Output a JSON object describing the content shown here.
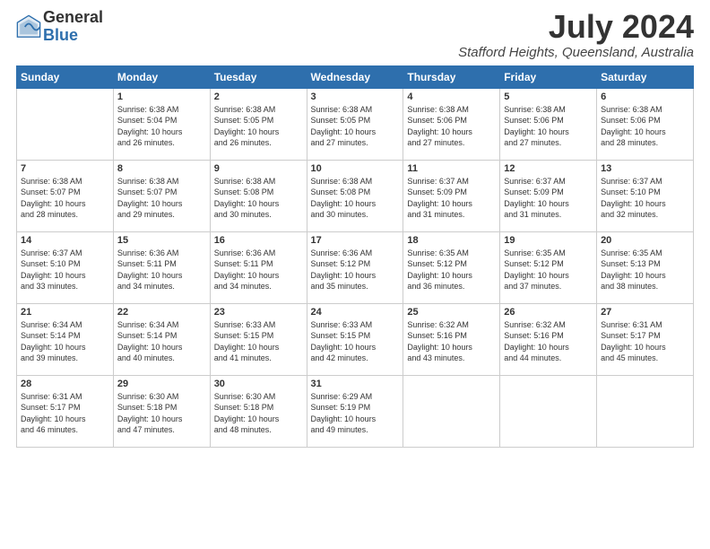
{
  "header": {
    "logo_general": "General",
    "logo_blue": "Blue",
    "month_year": "July 2024",
    "location": "Stafford Heights, Queensland, Australia"
  },
  "weekdays": [
    "Sunday",
    "Monday",
    "Tuesday",
    "Wednesday",
    "Thursday",
    "Friday",
    "Saturday"
  ],
  "weeks": [
    [
      {
        "day": "",
        "info": ""
      },
      {
        "day": "1",
        "info": "Sunrise: 6:38 AM\nSunset: 5:04 PM\nDaylight: 10 hours\nand 26 minutes."
      },
      {
        "day": "2",
        "info": "Sunrise: 6:38 AM\nSunset: 5:05 PM\nDaylight: 10 hours\nand 26 minutes."
      },
      {
        "day": "3",
        "info": "Sunrise: 6:38 AM\nSunset: 5:05 PM\nDaylight: 10 hours\nand 27 minutes."
      },
      {
        "day": "4",
        "info": "Sunrise: 6:38 AM\nSunset: 5:06 PM\nDaylight: 10 hours\nand 27 minutes."
      },
      {
        "day": "5",
        "info": "Sunrise: 6:38 AM\nSunset: 5:06 PM\nDaylight: 10 hours\nand 27 minutes."
      },
      {
        "day": "6",
        "info": "Sunrise: 6:38 AM\nSunset: 5:06 PM\nDaylight: 10 hours\nand 28 minutes."
      }
    ],
    [
      {
        "day": "7",
        "info": "Sunrise: 6:38 AM\nSunset: 5:07 PM\nDaylight: 10 hours\nand 28 minutes."
      },
      {
        "day": "8",
        "info": "Sunrise: 6:38 AM\nSunset: 5:07 PM\nDaylight: 10 hours\nand 29 minutes."
      },
      {
        "day": "9",
        "info": "Sunrise: 6:38 AM\nSunset: 5:08 PM\nDaylight: 10 hours\nand 30 minutes."
      },
      {
        "day": "10",
        "info": "Sunrise: 6:38 AM\nSunset: 5:08 PM\nDaylight: 10 hours\nand 30 minutes."
      },
      {
        "day": "11",
        "info": "Sunrise: 6:37 AM\nSunset: 5:09 PM\nDaylight: 10 hours\nand 31 minutes."
      },
      {
        "day": "12",
        "info": "Sunrise: 6:37 AM\nSunset: 5:09 PM\nDaylight: 10 hours\nand 31 minutes."
      },
      {
        "day": "13",
        "info": "Sunrise: 6:37 AM\nSunset: 5:10 PM\nDaylight: 10 hours\nand 32 minutes."
      }
    ],
    [
      {
        "day": "14",
        "info": "Sunrise: 6:37 AM\nSunset: 5:10 PM\nDaylight: 10 hours\nand 33 minutes."
      },
      {
        "day": "15",
        "info": "Sunrise: 6:36 AM\nSunset: 5:11 PM\nDaylight: 10 hours\nand 34 minutes."
      },
      {
        "day": "16",
        "info": "Sunrise: 6:36 AM\nSunset: 5:11 PM\nDaylight: 10 hours\nand 34 minutes."
      },
      {
        "day": "17",
        "info": "Sunrise: 6:36 AM\nSunset: 5:12 PM\nDaylight: 10 hours\nand 35 minutes."
      },
      {
        "day": "18",
        "info": "Sunrise: 6:35 AM\nSunset: 5:12 PM\nDaylight: 10 hours\nand 36 minutes."
      },
      {
        "day": "19",
        "info": "Sunrise: 6:35 AM\nSunset: 5:12 PM\nDaylight: 10 hours\nand 37 minutes."
      },
      {
        "day": "20",
        "info": "Sunrise: 6:35 AM\nSunset: 5:13 PM\nDaylight: 10 hours\nand 38 minutes."
      }
    ],
    [
      {
        "day": "21",
        "info": "Sunrise: 6:34 AM\nSunset: 5:14 PM\nDaylight: 10 hours\nand 39 minutes."
      },
      {
        "day": "22",
        "info": "Sunrise: 6:34 AM\nSunset: 5:14 PM\nDaylight: 10 hours\nand 40 minutes."
      },
      {
        "day": "23",
        "info": "Sunrise: 6:33 AM\nSunset: 5:15 PM\nDaylight: 10 hours\nand 41 minutes."
      },
      {
        "day": "24",
        "info": "Sunrise: 6:33 AM\nSunset: 5:15 PM\nDaylight: 10 hours\nand 42 minutes."
      },
      {
        "day": "25",
        "info": "Sunrise: 6:32 AM\nSunset: 5:16 PM\nDaylight: 10 hours\nand 43 minutes."
      },
      {
        "day": "26",
        "info": "Sunrise: 6:32 AM\nSunset: 5:16 PM\nDaylight: 10 hours\nand 44 minutes."
      },
      {
        "day": "27",
        "info": "Sunrise: 6:31 AM\nSunset: 5:17 PM\nDaylight: 10 hours\nand 45 minutes."
      }
    ],
    [
      {
        "day": "28",
        "info": "Sunrise: 6:31 AM\nSunset: 5:17 PM\nDaylight: 10 hours\nand 46 minutes."
      },
      {
        "day": "29",
        "info": "Sunrise: 6:30 AM\nSunset: 5:18 PM\nDaylight: 10 hours\nand 47 minutes."
      },
      {
        "day": "30",
        "info": "Sunrise: 6:30 AM\nSunset: 5:18 PM\nDaylight: 10 hours\nand 48 minutes."
      },
      {
        "day": "31",
        "info": "Sunrise: 6:29 AM\nSunset: 5:19 PM\nDaylight: 10 hours\nand 49 minutes."
      },
      {
        "day": "",
        "info": ""
      },
      {
        "day": "",
        "info": ""
      },
      {
        "day": "",
        "info": ""
      }
    ]
  ]
}
